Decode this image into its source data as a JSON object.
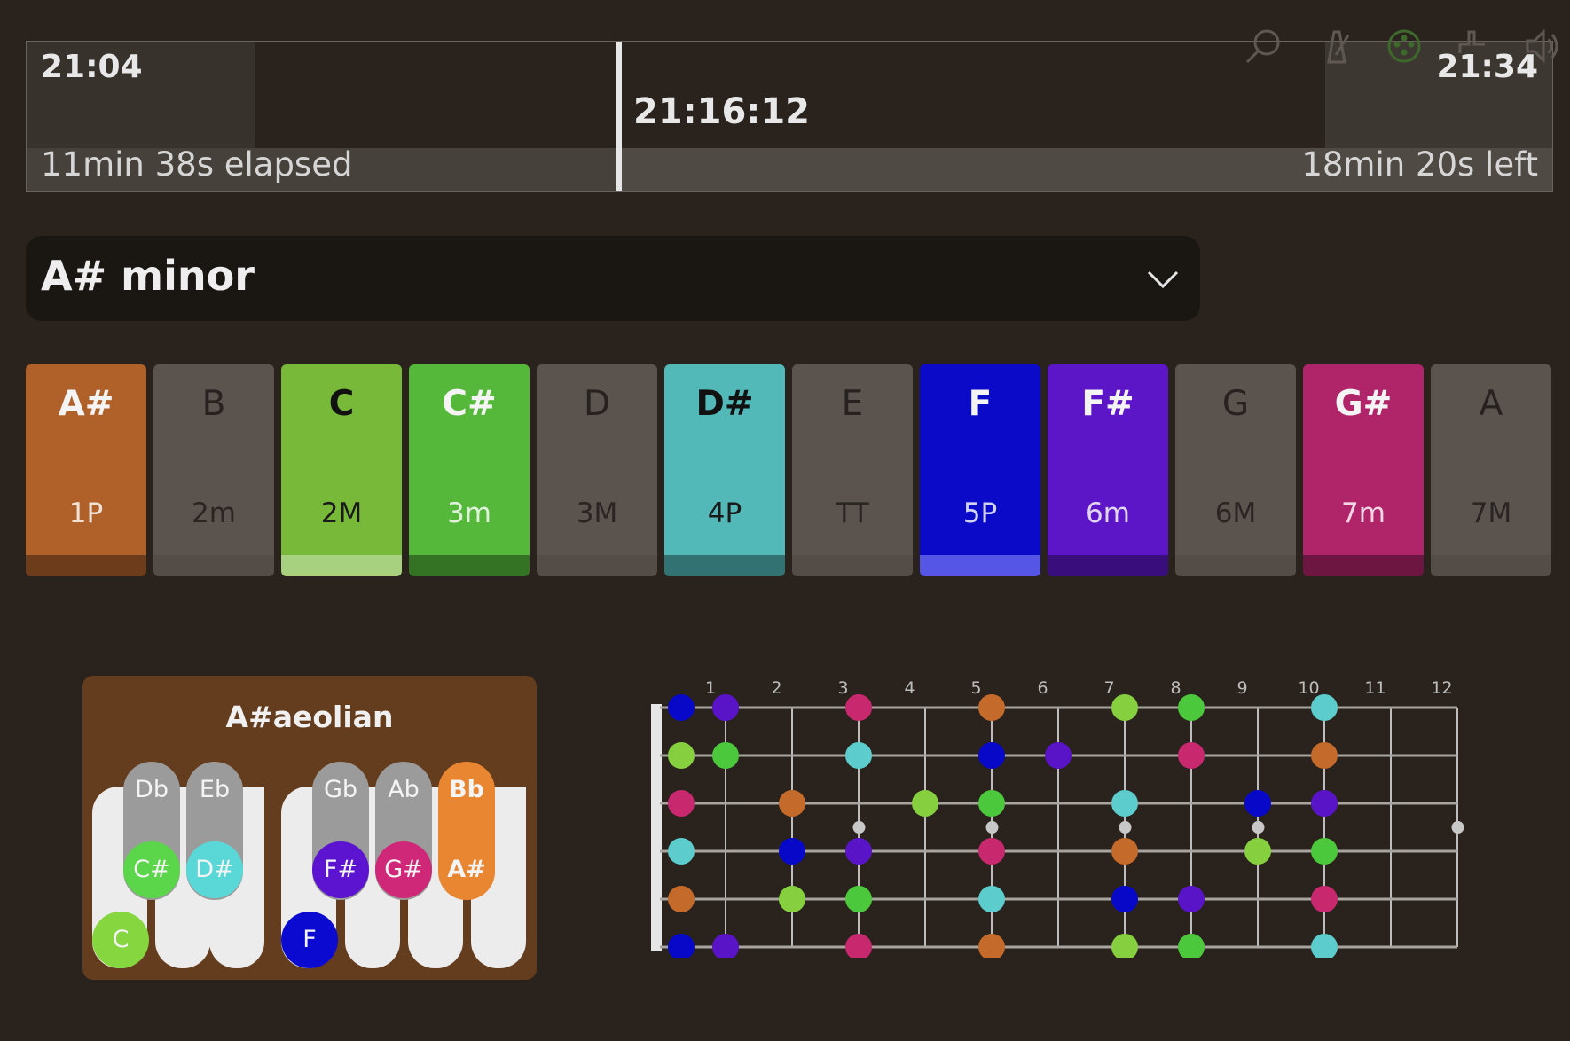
{
  "timeline": {
    "start_time": "21:04",
    "end_time": "21:34",
    "current_time": "21:16:12",
    "elapsed_label": "11min 38s elapsed",
    "left_label": "18min 20s left",
    "progress": 0.388
  },
  "toolbar": {
    "icons": [
      "search-icon",
      "metronome-icon",
      "midi-icon",
      "tuning-fork-icon",
      "volume-icon"
    ]
  },
  "scale_select": {
    "value": "A# minor"
  },
  "note_keys": [
    {
      "note": "A#",
      "interval": "1P",
      "active": true,
      "color": "#b0612a"
    },
    {
      "note": "B",
      "interval": "2m",
      "active": false,
      "color": "#5b534e"
    },
    {
      "note": "C",
      "interval": "2M",
      "active": true,
      "color": "#78b93a"
    },
    {
      "note": "C#",
      "interval": "3m",
      "active": true,
      "color": "#55b83a"
    },
    {
      "note": "D",
      "interval": "3M",
      "active": false,
      "color": "#5b534e"
    },
    {
      "note": "D#",
      "interval": "4P",
      "active": true,
      "color": "#52b8b8"
    },
    {
      "note": "E",
      "interval": "TT",
      "active": false,
      "color": "#5b534e"
    },
    {
      "note": "F",
      "interval": "5P",
      "active": true,
      "color": "#0a0ac8"
    },
    {
      "note": "F#",
      "interval": "6m",
      "active": true,
      "color": "#5c16c8"
    },
    {
      "note": "G",
      "interval": "6M",
      "active": false,
      "color": "#5b534e"
    },
    {
      "note": "G#",
      "interval": "7m",
      "active": true,
      "color": "#b0246a"
    },
    {
      "note": "A",
      "interval": "7M",
      "active": false,
      "color": "#5b534e"
    }
  ],
  "piano": {
    "title": "A#aeolian",
    "black_keys": [
      {
        "label": "Db",
        "note": "C#",
        "color": "#5bd64a"
      },
      {
        "label": "Eb",
        "note": "D#",
        "color": "#5ad8d8"
      },
      {
        "label": "Gb",
        "note": "F#",
        "color": "#5c14d0"
      },
      {
        "label": "Ab",
        "note": "G#",
        "color": "#d02878"
      },
      {
        "label": "Bb",
        "note": "A#",
        "color": "#e98632"
      }
    ],
    "white_notes": [
      {
        "note": "C",
        "color": "#86d640"
      },
      {
        "note": "F",
        "color": "#0a0ad0"
      }
    ]
  },
  "fretboard": {
    "fret_numbers": [
      "1",
      "2",
      "3",
      "4",
      "5",
      "6",
      "7",
      "8",
      "9",
      "10",
      "11",
      "12"
    ],
    "inlay_frets": [
      3,
      5,
      7,
      9,
      12
    ],
    "note_colors": {
      "A#": "#c46a2a",
      "C": "#86d040",
      "C#": "#4cc83c",
      "D#": "#5ccccc",
      "F": "#0808c8",
      "F#": "#5a14c8",
      "G#": "#c8286e"
    },
    "strings": [
      {
        "open": "F",
        "dots": [
          [
            0,
            "F"
          ],
          [
            1,
            "F#"
          ],
          [
            3,
            "G#"
          ],
          [
            5,
            "A#"
          ],
          [
            7,
            "C"
          ],
          [
            8,
            "C#"
          ],
          [
            10,
            "D#"
          ]
        ]
      },
      {
        "open": "C",
        "dots": [
          [
            0,
            "C"
          ],
          [
            1,
            "C#"
          ],
          [
            3,
            "D#"
          ],
          [
            5,
            "F"
          ],
          [
            6,
            "F#"
          ],
          [
            8,
            "G#"
          ],
          [
            10,
            "A#"
          ]
        ]
      },
      {
        "open": "G#",
        "dots": [
          [
            0,
            "G#"
          ],
          [
            2,
            "A#"
          ],
          [
            4,
            "C"
          ],
          [
            5,
            "C#"
          ],
          [
            7,
            "D#"
          ],
          [
            9,
            "F"
          ],
          [
            10,
            "F#"
          ]
        ]
      },
      {
        "open": "D#",
        "dots": [
          [
            0,
            "D#"
          ],
          [
            2,
            "F"
          ],
          [
            3,
            "F#"
          ],
          [
            5,
            "G#"
          ],
          [
            7,
            "A#"
          ],
          [
            9,
            "C"
          ],
          [
            10,
            "C#"
          ]
        ]
      },
      {
        "open": "A#",
        "dots": [
          [
            0,
            "A#"
          ],
          [
            2,
            "C"
          ],
          [
            3,
            "C#"
          ],
          [
            5,
            "D#"
          ],
          [
            7,
            "F"
          ],
          [
            8,
            "F#"
          ],
          [
            10,
            "G#"
          ]
        ]
      },
      {
        "open": "F",
        "dots": [
          [
            0,
            "F"
          ],
          [
            1,
            "F#"
          ],
          [
            3,
            "G#"
          ],
          [
            5,
            "A#"
          ],
          [
            7,
            "C"
          ],
          [
            8,
            "C#"
          ],
          [
            10,
            "D#"
          ]
        ]
      }
    ]
  }
}
